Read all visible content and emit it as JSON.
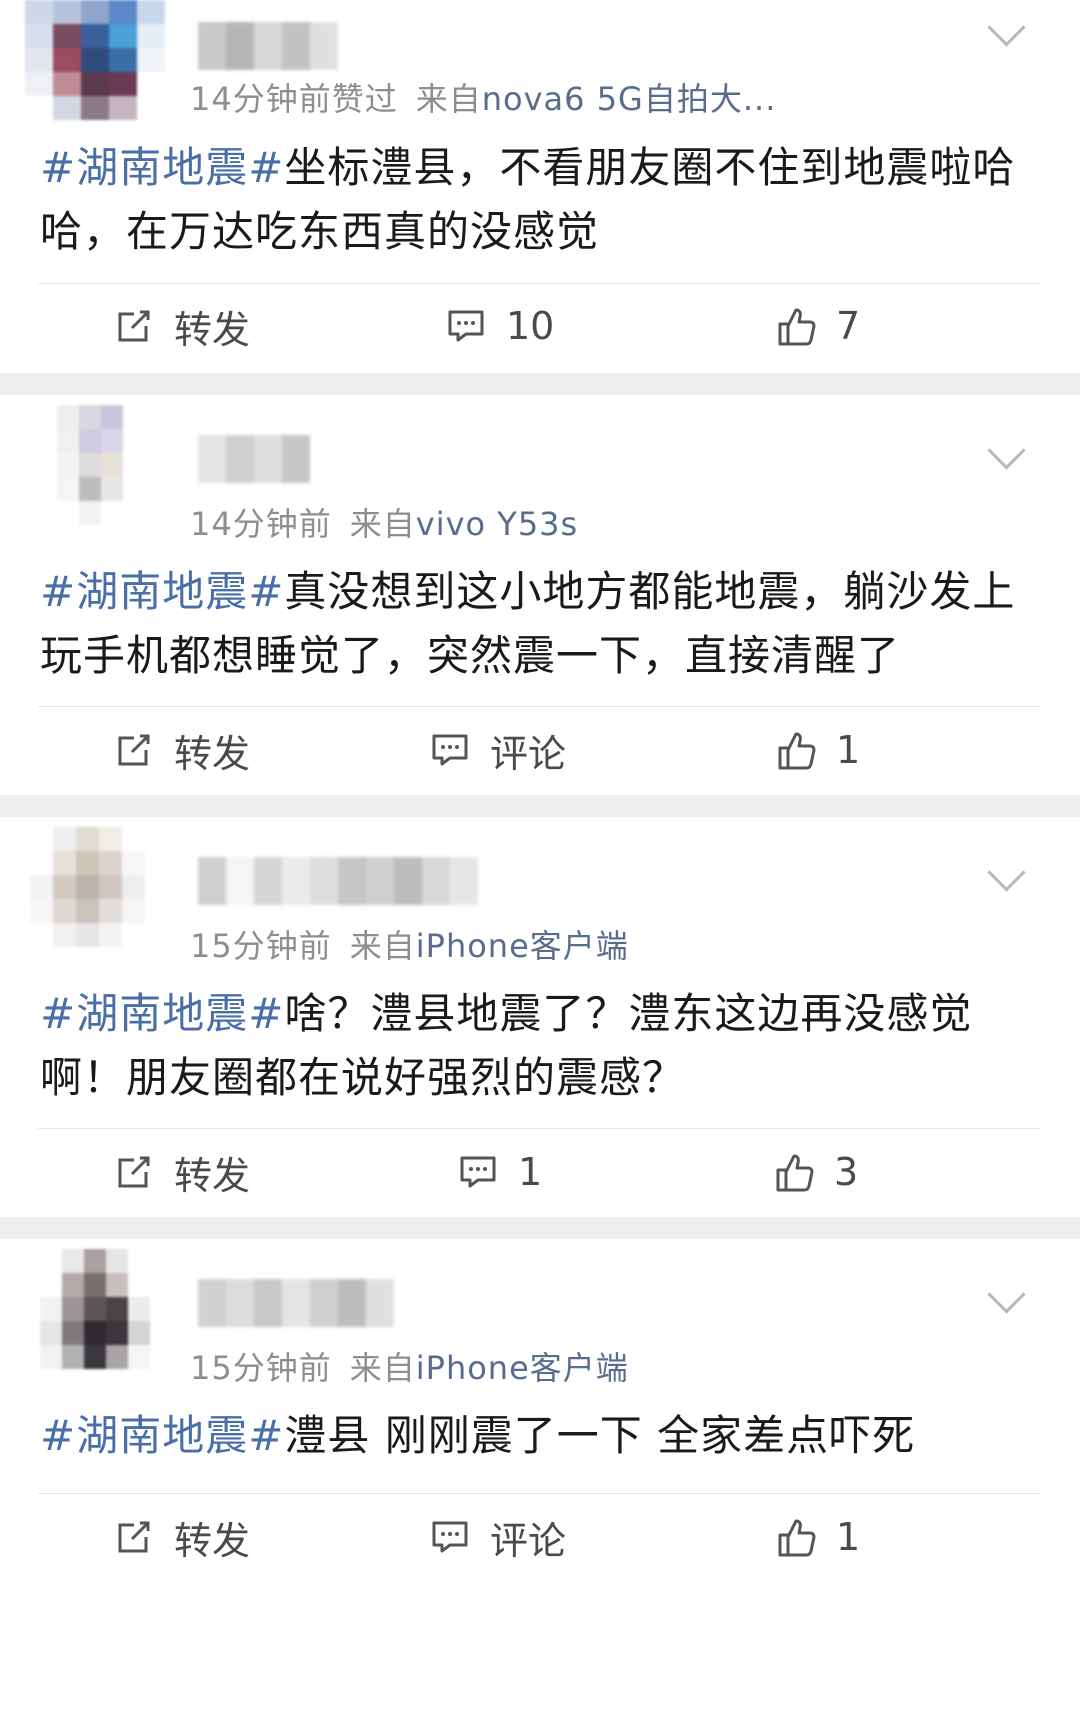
{
  "posts": [
    {
      "meta_time": "14分钟前赞过",
      "meta_from": "来自",
      "meta_source": "nova6 5G自拍大...",
      "hashtag": "#湖南地震#",
      "body": "坐标澧县，不看朋友圈不住到地震啦哈哈，在万达吃东西真的没感觉",
      "repost_label": "转发",
      "comment_label": "10",
      "like_label": "7"
    },
    {
      "meta_time": "14分钟前",
      "meta_from": "来自",
      "meta_source": "vivo Y53s",
      "hashtag": "#湖南地震#",
      "body": "真没想到这小地方都能地震，躺沙发上玩手机都想睡觉了，突然震一下，直接清醒了",
      "repost_label": "转发",
      "comment_label": "评论",
      "like_label": "1"
    },
    {
      "meta_time": "15分钟前",
      "meta_from": "来自",
      "meta_source": "iPhone客户端",
      "hashtag": "#湖南地震#",
      "body": "啥？澧县地震了？澧东这边再没感觉啊！朋友圈都在说好强烈的震感？",
      "repost_label": "转发",
      "comment_label": "1",
      "like_label": "3"
    },
    {
      "meta_time": "15分钟前",
      "meta_from": "来自",
      "meta_source": "iPhone客户端",
      "hashtag": "#湖南地震#",
      "body": "澧县 刚刚震了一下 全家差点吓死",
      "repost_label": "转发",
      "comment_label": "评论",
      "like_label": "1"
    }
  ],
  "colors": {
    "hashtag": "#4a6fa8",
    "source": "#5a6c8e",
    "meta": "#8e8e8e",
    "separator": "#eeeeee"
  },
  "icons": {
    "repost": "repost-icon",
    "comment": "comment-icon",
    "like": "thumbs-up-icon",
    "menu": "chevron-down-icon"
  }
}
